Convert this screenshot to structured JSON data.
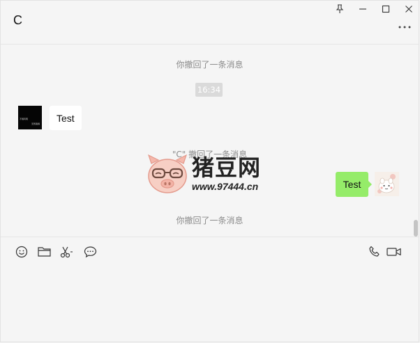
{
  "window": {
    "title": "C",
    "pin_icon": "pin-icon",
    "minimize_icon": "minimize-icon",
    "maximize_icon": "maximize-icon",
    "close_icon": "close-icon",
    "more_icon": "more-options-icon"
  },
  "messages": {
    "recall_1": "你撤回了一条消息",
    "timestamp": "16:34",
    "incoming_text": "Test",
    "recall_2": "\"C\" 撤回了一条消息",
    "outgoing_text": "Test",
    "recall_3": "你撤回了一条消息",
    "sender_avatar_text": [
      "不惧风雨",
      "无所畏惧"
    ]
  },
  "watermark": {
    "title": "猪豆网",
    "url": "www.97444.cn"
  },
  "toolbar": {
    "emoji_icon": "emoji-icon",
    "file_icon": "folder-icon",
    "screenshot_icon": "scissors-icon",
    "chat_history_icon": "chat-bubble-icon",
    "voice_call_icon": "phone-icon",
    "video_call_icon": "video-camera-icon"
  },
  "input": {
    "value": ""
  },
  "colors": {
    "background": "#f5f5f5",
    "outgoing_bubble": "#95ec69",
    "incoming_bubble": "#ffffff",
    "system_text": "#8b8b8b",
    "timestamp_bg": "#dadada"
  }
}
